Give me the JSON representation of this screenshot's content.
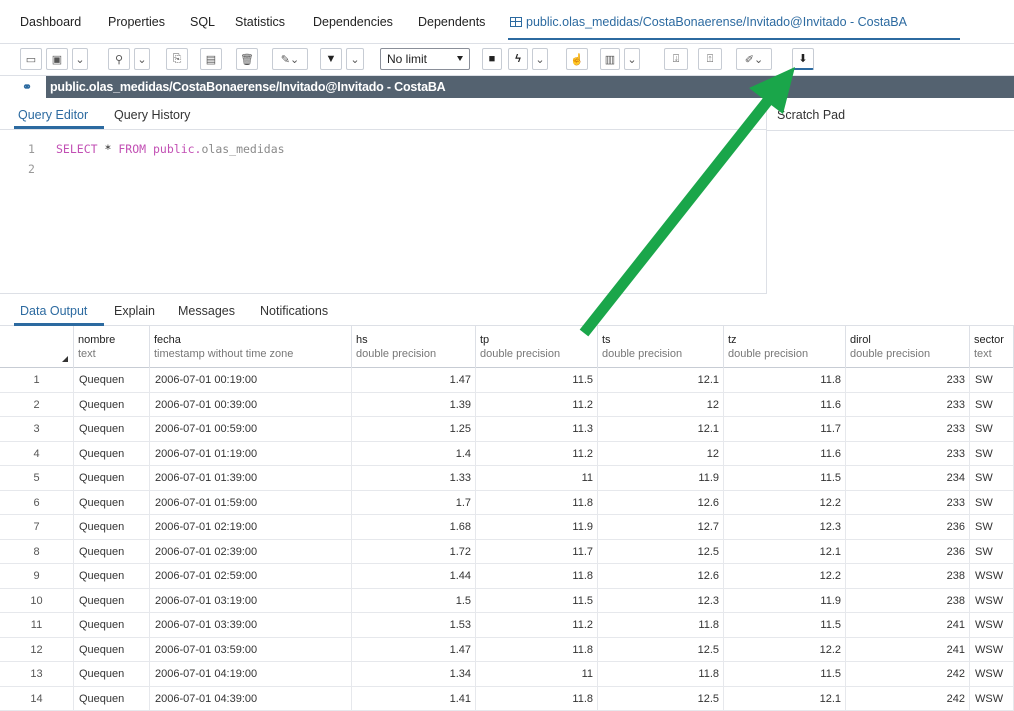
{
  "top_tabs": [
    "Dashboard",
    "Properties",
    "SQL",
    "Statistics",
    "Dependencies",
    "Dependents"
  ],
  "active_tab": "public.olas_medidas/CostaBonaerense/Invitado@Invitado - CostaBA",
  "toolbar": {
    "limit_value": "No limit"
  },
  "connection": {
    "label": "public.olas_medidas/CostaBonaerense/Invitado@Invitado - CostaBA"
  },
  "editor": {
    "tabs": [
      "Query Editor",
      "Query History"
    ],
    "line_numbers": [
      "1",
      "2"
    ],
    "query": {
      "select": "SELECT",
      "star": "*",
      "from": "FROM",
      "schema": "public.",
      "table": "olas_medidas"
    },
    "scratch_title": "Scratch Pad"
  },
  "output_tabs": [
    "Data Output",
    "Explain",
    "Messages",
    "Notifications"
  ],
  "grid": {
    "columns": [
      {
        "name": "nombre",
        "type": "text"
      },
      {
        "name": "fecha",
        "type": "timestamp without time zone"
      },
      {
        "name": "hs",
        "type": "double precision"
      },
      {
        "name": "tp",
        "type": "double precision"
      },
      {
        "name": "ts",
        "type": "double precision"
      },
      {
        "name": "tz",
        "type": "double precision"
      },
      {
        "name": "dirol",
        "type": "double precision"
      },
      {
        "name": "sector",
        "type": "text"
      }
    ],
    "rows": [
      [
        "1",
        "Quequen",
        "2006-07-01 00:19:00",
        "1.47",
        "11.5",
        "12.1",
        "11.8",
        "233",
        "SW"
      ],
      [
        "2",
        "Quequen",
        "2006-07-01 00:39:00",
        "1.39",
        "11.2",
        "12",
        "11.6",
        "233",
        "SW"
      ],
      [
        "3",
        "Quequen",
        "2006-07-01 00:59:00",
        "1.25",
        "11.3",
        "12.1",
        "11.7",
        "233",
        "SW"
      ],
      [
        "4",
        "Quequen",
        "2006-07-01 01:19:00",
        "1.4",
        "11.2",
        "12",
        "11.6",
        "233",
        "SW"
      ],
      [
        "5",
        "Quequen",
        "2006-07-01 01:39:00",
        "1.33",
        "11",
        "11.9",
        "11.5",
        "234",
        "SW"
      ],
      [
        "6",
        "Quequen",
        "2006-07-01 01:59:00",
        "1.7",
        "11.8",
        "12.6",
        "12.2",
        "233",
        "SW"
      ],
      [
        "7",
        "Quequen",
        "2006-07-01 02:19:00",
        "1.68",
        "11.9",
        "12.7",
        "12.3",
        "236",
        "SW"
      ],
      [
        "8",
        "Quequen",
        "2006-07-01 02:39:00",
        "1.72",
        "11.7",
        "12.5",
        "12.1",
        "236",
        "SW"
      ],
      [
        "9",
        "Quequen",
        "2006-07-01 02:59:00",
        "1.44",
        "11.8",
        "12.6",
        "12.2",
        "238",
        "WSW"
      ],
      [
        "10",
        "Quequen",
        "2006-07-01 03:19:00",
        "1.5",
        "11.5",
        "12.3",
        "11.9",
        "238",
        "WSW"
      ],
      [
        "11",
        "Quequen",
        "2006-07-01 03:39:00",
        "1.53",
        "11.2",
        "11.8",
        "11.5",
        "241",
        "WSW"
      ],
      [
        "12",
        "Quequen",
        "2006-07-01 03:59:00",
        "1.47",
        "11.8",
        "12.5",
        "12.2",
        "241",
        "WSW"
      ],
      [
        "13",
        "Quequen",
        "2006-07-01 04:19:00",
        "1.34",
        "11",
        "11.8",
        "11.5",
        "242",
        "WSW"
      ],
      [
        "14",
        "Quequen",
        "2006-07-01 04:39:00",
        "1.41",
        "11.8",
        "12.5",
        "12.1",
        "242",
        "WSW"
      ]
    ]
  },
  "colors": {
    "accent": "#2c6aa0",
    "connection_bar": "#546270",
    "annotation_arrow": "#1aa64a"
  }
}
